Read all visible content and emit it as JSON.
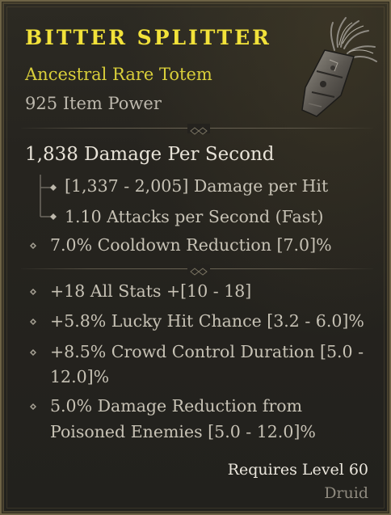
{
  "item": {
    "name": "BITTER SPLITTER",
    "type_line": "Ancestral Rare Totem",
    "item_power": "925 Item Power",
    "icon": "totem-item-icon"
  },
  "damage": {
    "dps": "1,838 Damage Per Second",
    "per_hit": "[1,337 - 2,005] Damage per Hit",
    "attack_speed": "1.10 Attacks per Second (Fast)"
  },
  "implicit": {
    "affix": "7.0% Cooldown Reduction [7.0]%"
  },
  "affixes": [
    {
      "line1": "+18 All Stats +[10 - 18]",
      "line2": ""
    },
    {
      "line1": "+5.8% Lucky Hit Chance [3.2 - 6.0]%",
      "line2": ""
    },
    {
      "line1": "+8.5% Crowd Control Duration [5.0 -",
      "line2": "12.0]%"
    },
    {
      "line1": "5.0% Damage Reduction from",
      "line2": "Poisoned Enemies [5.0 - 12.0]%"
    }
  ],
  "requirements": {
    "level": "Requires Level 60",
    "class": "Druid"
  },
  "colors": {
    "rare_title": "#f2e23a",
    "rare_type": "#d9cf3a",
    "affix_text": "#c7c2b5",
    "border": "#6e6346"
  }
}
